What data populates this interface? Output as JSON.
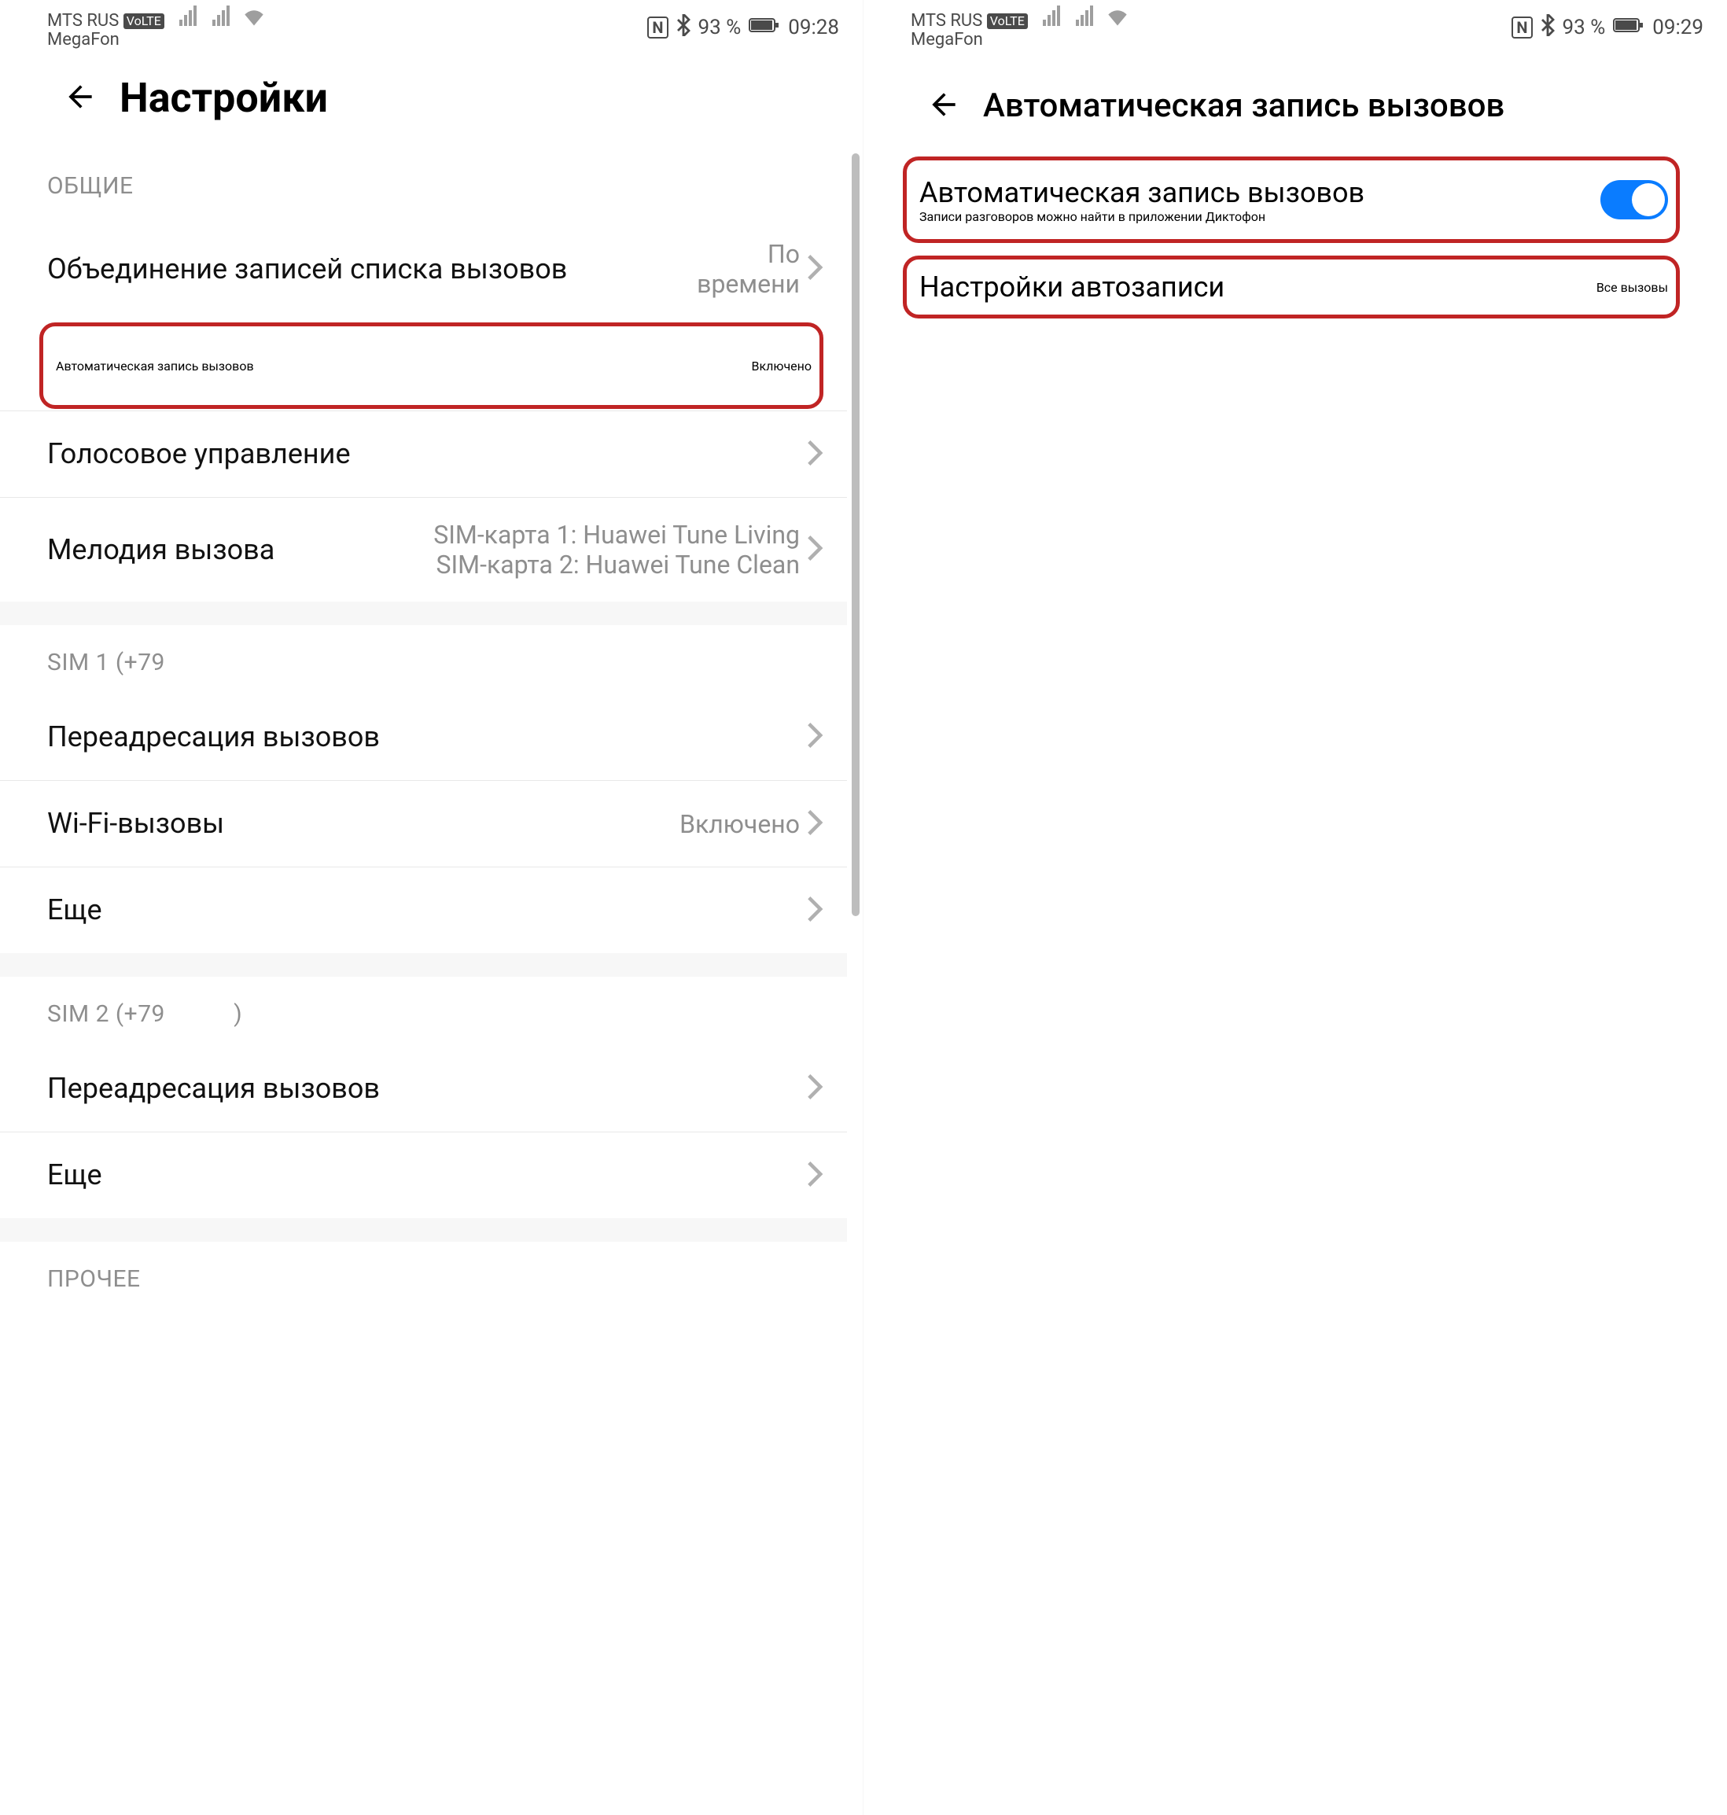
{
  "left": {
    "status": {
      "carrier_line1": "MTS RUS",
      "volte": "VoLTE",
      "carrier_line2": "MegaFon",
      "nfc": "N",
      "bt": "✳",
      "battery_pct": "93 %",
      "time": "09:28"
    },
    "header": {
      "title": "Настройки"
    },
    "sec_general": "ОБЩИЕ",
    "rows": {
      "merge": {
        "label": "Объединение записей списка вызовов",
        "value_l1": "По",
        "value_l2": "времени"
      },
      "autorec": {
        "label": "Автоматическая запись вызовов",
        "value": "Включено"
      },
      "voice": {
        "label": "Голосовое управление"
      },
      "ringtone": {
        "label": "Мелодия вызова",
        "v1": "SIM-карта 1: Huawei Tune Living",
        "v2": "SIM-карта 2: Huawei Tune Clean"
      }
    },
    "sec_sim1": "SIM 1 (+79",
    "sec_sim1_tail": ")",
    "sim1": {
      "fwd": {
        "label": "Переадресация вызовов"
      },
      "wifi": {
        "label": "Wi-Fi-вызовы",
        "value": "Включено"
      },
      "more": {
        "label": "Еще"
      }
    },
    "sec_sim2": "SIM 2 (+79",
    "sec_sim2_tail": ")",
    "sim2": {
      "fwd": {
        "label": "Переадресация вызовов"
      },
      "more": {
        "label": "Еще"
      }
    },
    "sec_other": "ПРОЧЕЕ"
  },
  "right": {
    "status": {
      "carrier_line1": "MTS RUS",
      "volte": "VoLTE",
      "carrier_line2": "MegaFon",
      "nfc": "N",
      "bt": "✳",
      "battery_pct": "93 %",
      "time": "09:29"
    },
    "header": {
      "title": "Автоматическая запись вызовов"
    },
    "toggle_row": {
      "title": "Автоматическая запись вызовов",
      "desc": "Записи разговоров можно найти в приложении Диктофон"
    },
    "settings_row": {
      "label": "Настройки автозаписи",
      "value": "Все вызовы"
    }
  }
}
